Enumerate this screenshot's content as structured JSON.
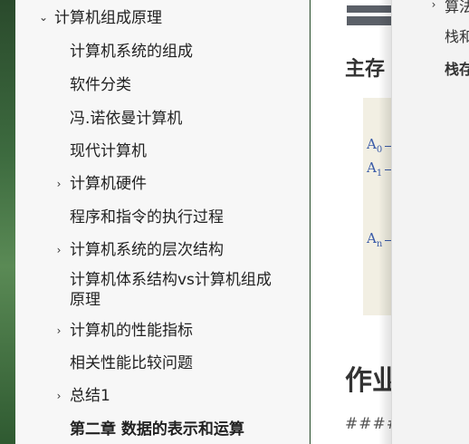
{
  "sidebar": {
    "items": [
      {
        "label": "计算机组成原理",
        "chevron": "down"
      },
      {
        "label": "计算机系统的组成"
      },
      {
        "label": "软件分类"
      },
      {
        "label": "冯.诺依曼计算机"
      },
      {
        "label": "现代计算机"
      },
      {
        "label": "计算机硬件",
        "chevron": "right"
      },
      {
        "label": "程序和指令的执行过程"
      },
      {
        "label": "计算机系统的层次结构",
        "chevron": "right"
      },
      {
        "label": "计算机体系结构vs计算机组成"
      },
      {
        "label": "原理"
      },
      {
        "label": "计算机的性能指标",
        "chevron": "right"
      },
      {
        "label": "相关性能比较问题"
      },
      {
        "label": "总结1",
        "chevron": "right"
      },
      {
        "label": "第二章 数据的表示和运算"
      }
    ]
  },
  "document": {
    "heading1": "主存",
    "figure_labels": {
      "a0": "A",
      "a0_sub": "0",
      "a1": "A",
      "a1_sub": "1",
      "an": "A",
      "an_sub": "n"
    },
    "heading2": "作业",
    "hash_text": "####"
  },
  "outline_panel": {
    "items": [
      {
        "label": "算法"
      },
      {
        "label": "栈和"
      },
      {
        "label": "栈存"
      }
    ]
  },
  "icons": {
    "chevron_down": "⌄",
    "chevron_right": "›"
  }
}
